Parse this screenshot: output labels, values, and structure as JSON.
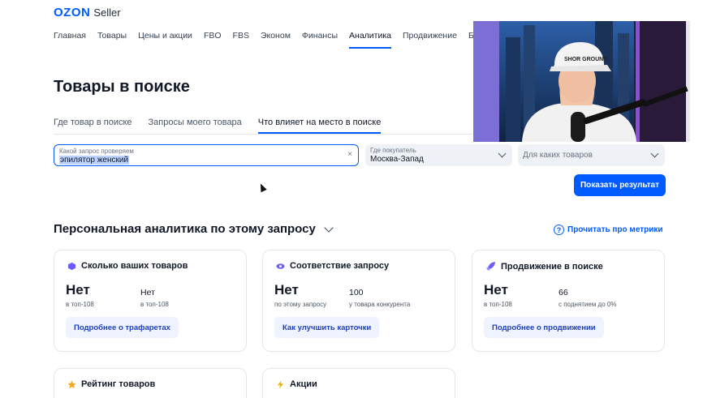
{
  "logo": {
    "brand": "OZON",
    "suffix": "Seller"
  },
  "nav": [
    {
      "label": "Главная",
      "active": false
    },
    {
      "label": "Товары",
      "active": false
    },
    {
      "label": "Цены и акции",
      "active": false
    },
    {
      "label": "FBO",
      "active": false
    },
    {
      "label": "FBS",
      "active": false
    },
    {
      "label": "Эконом",
      "active": false
    },
    {
      "label": "Финансы",
      "active": false
    },
    {
      "label": "Аналитика",
      "active": true
    },
    {
      "label": "Продвижение",
      "active": false
    },
    {
      "label": "Банк",
      "active": false
    }
  ],
  "page_title": "Товары в поиске",
  "subtabs": [
    {
      "label": "Где товар в поиске",
      "active": false
    },
    {
      "label": "Запросы моего товара",
      "active": false
    },
    {
      "label": "Что влияет на место в поиске",
      "active": true
    }
  ],
  "query": {
    "label": "Какой запрос проверяем",
    "value": "эпилятор женский",
    "clear": "×"
  },
  "region": {
    "label": "Где покупатель",
    "value": "Москва-Запад"
  },
  "products": {
    "placeholder": "Для каких товаров"
  },
  "show_button": "Показать результат",
  "section": {
    "title": "Персональная аналитика по этому запросу",
    "metrics_link": "Прочитать про метрики",
    "help_glyph": "?"
  },
  "cards": {
    "count": {
      "title": "Сколько ваших товаров",
      "main_value": "Нет",
      "main_caption": "в топ-108",
      "second_value": "Нет",
      "second_caption": "в топ-108",
      "button": "Подробнее о трафаретах"
    },
    "relevance": {
      "title": "Соответствие запросу",
      "main_value": "Нет",
      "main_caption": "по этому запросу",
      "second_value": "100",
      "second_caption": "у товара конкурента",
      "button": "Как улучшить карточки"
    },
    "promotion": {
      "title": "Продвижение в поиске",
      "main_value": "Нет",
      "main_caption": "в топ-108",
      "second_value": "66",
      "second_caption": "с поднятием до 0%",
      "button": "Подробнее о продвижении"
    },
    "rating": {
      "title": "Рейтинг товаров"
    },
    "promos": {
      "title": "Акции"
    }
  },
  "video_cap_text": "SHOR GROUND",
  "colors": {
    "accent": "#005bff",
    "text": "#111827",
    "field_bg": "#eef1f5"
  },
  "icons": [
    "clear-icon",
    "chevron-down-icon",
    "help-icon",
    "cube-icon",
    "eye-icon",
    "rocket-icon",
    "star-icon",
    "lightning-icon"
  ]
}
